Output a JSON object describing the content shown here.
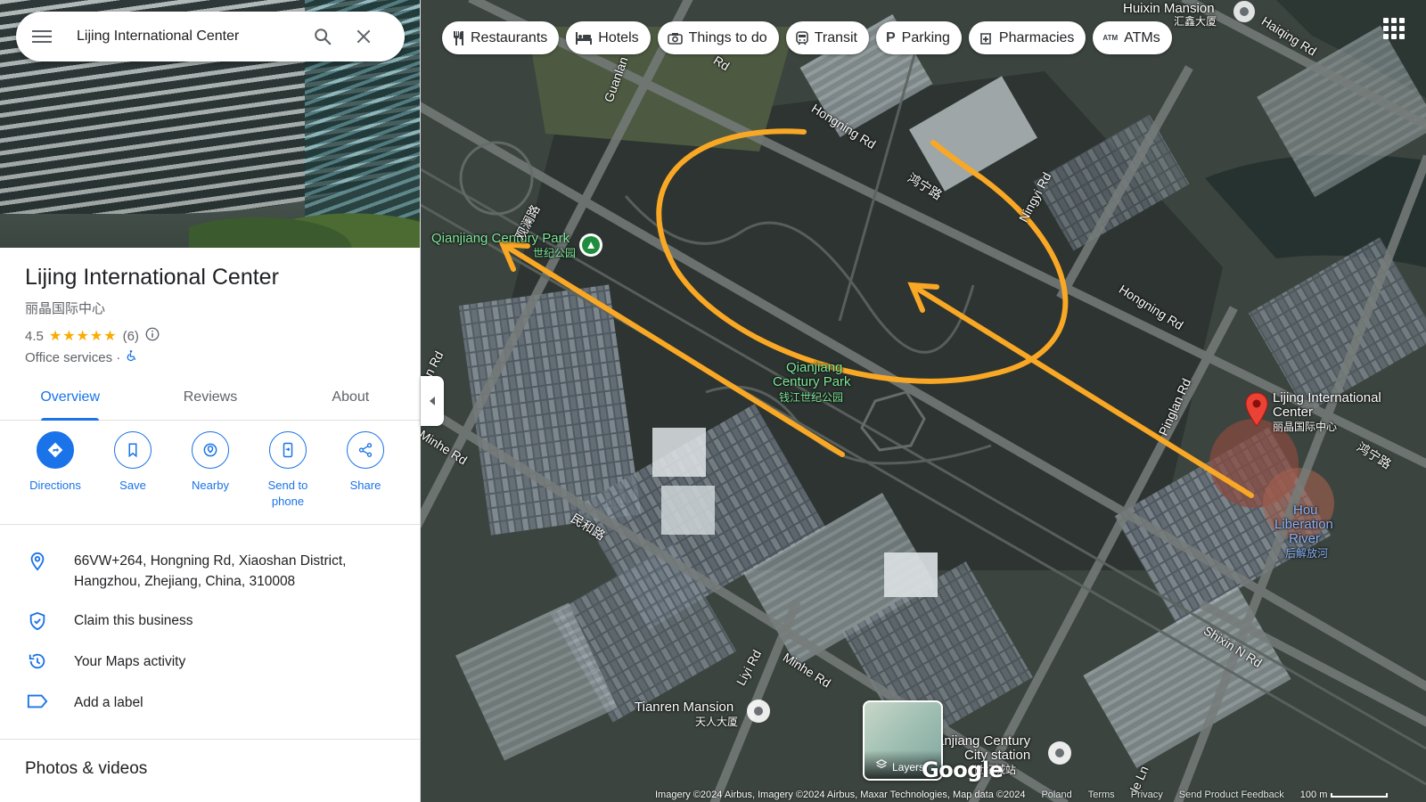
{
  "search": {
    "query": "Lijing International Center"
  },
  "place": {
    "title": "Lijing International Center",
    "subtitle": "丽晶国际中心",
    "rating": "4.5",
    "stars": "★★★★★",
    "review_count": "(6)",
    "category": "Office services ·",
    "accessibility_icon": "wheelchair-icon"
  },
  "tabs": [
    {
      "label": "Overview",
      "active": true
    },
    {
      "label": "Reviews",
      "active": false
    },
    {
      "label": "About",
      "active": false
    }
  ],
  "actions": [
    {
      "label": "Directions",
      "icon": "directions-icon"
    },
    {
      "label": "Save",
      "icon": "bookmark-icon"
    },
    {
      "label": "Nearby",
      "icon": "nearby-icon"
    },
    {
      "label": "Send to\nphone",
      "icon": "send-to-phone-icon"
    },
    {
      "label": "Share",
      "icon": "share-icon"
    }
  ],
  "info": {
    "address_line1": "66VW+264, Hongning Rd, Xiaoshan District,",
    "address_line2": "Hangzhou, Zhejiang, China, 310008",
    "claim": "Claim this business",
    "activity": "Your Maps activity",
    "label": "Add a label"
  },
  "photos_heading": "Photos & videos",
  "chips": [
    {
      "label": "Restaurants",
      "icon": "restaurant-icon"
    },
    {
      "label": "Hotels",
      "icon": "hotel-icon"
    },
    {
      "label": "Things to do",
      "icon": "camera-icon"
    },
    {
      "label": "Transit",
      "icon": "transit-icon"
    },
    {
      "label": "Parking",
      "icon": "parking-icon"
    },
    {
      "label": "Pharmacies",
      "icon": "pharmacy-icon"
    },
    {
      "label": "ATMs",
      "icon": "atm-icon"
    }
  ],
  "map_labels": {
    "huixin": "Huixin Mansion",
    "huixin_cn": "汇鑫大厦",
    "qianjiang_park_pin": "Qianjiang Century Park",
    "qianjiang_park_pin_cn": "世纪公园",
    "qianjiang_park_center_1": "Qianjiang",
    "qianjiang_park_center_2": "Century Park",
    "qianjiang_park_center_cn": "钱江世纪公园",
    "lijing_1": "Lijing International",
    "lijing_2": "Center",
    "lijing_cn": "丽晶国际中心",
    "hou_1": "Hou",
    "hou_2": "Liberation",
    "hou_3": "River",
    "hou_cn": "后解放河",
    "tianren": "Tianren Mansion",
    "tianren_cn": "天人大厦",
    "station_1": "Qianjiang Century",
    "station_2": "City station",
    "station_cn": "世纪城站"
  },
  "road_labels": {
    "haiqing": "Haiqing Rd",
    "hongning_top": "Hongning Rd",
    "hongning_cn": "鸿宁路",
    "hongning_right": "Hongning Rd",
    "hongning_cn_right": "鸿宁路",
    "ningyi": "Ningyi Rd",
    "guanlan": "Guanlan",
    "guanlan_cn": "观澜路",
    "an_rd": "an Rd",
    "pinglan": "Pinglan Rd",
    "minhe_left": "Minhe Rd",
    "minhe_cn": "民和路",
    "minhe_bottom": "Minhe Rd",
    "liyi": "Liyi Rd",
    "shixin": "Shixin N Rd",
    "le_ln": "le Ln",
    "rd_top": "Rd"
  },
  "layers_label": "Layers",
  "google_logo": "Google",
  "footer": {
    "attribution": "Imagery ©2024 Airbus, Imagery ©2024 Airbus, Maxar Technologies, Map data ©2024",
    "region": "Poland",
    "terms": "Terms",
    "privacy": "Privacy",
    "feedback": "Send Product Feedback",
    "scale": "100 m"
  },
  "colors": {
    "accent": "#1a73e8",
    "annotation": "#f9a825",
    "pin_red": "#ea4335",
    "star": "#f9ab00"
  }
}
